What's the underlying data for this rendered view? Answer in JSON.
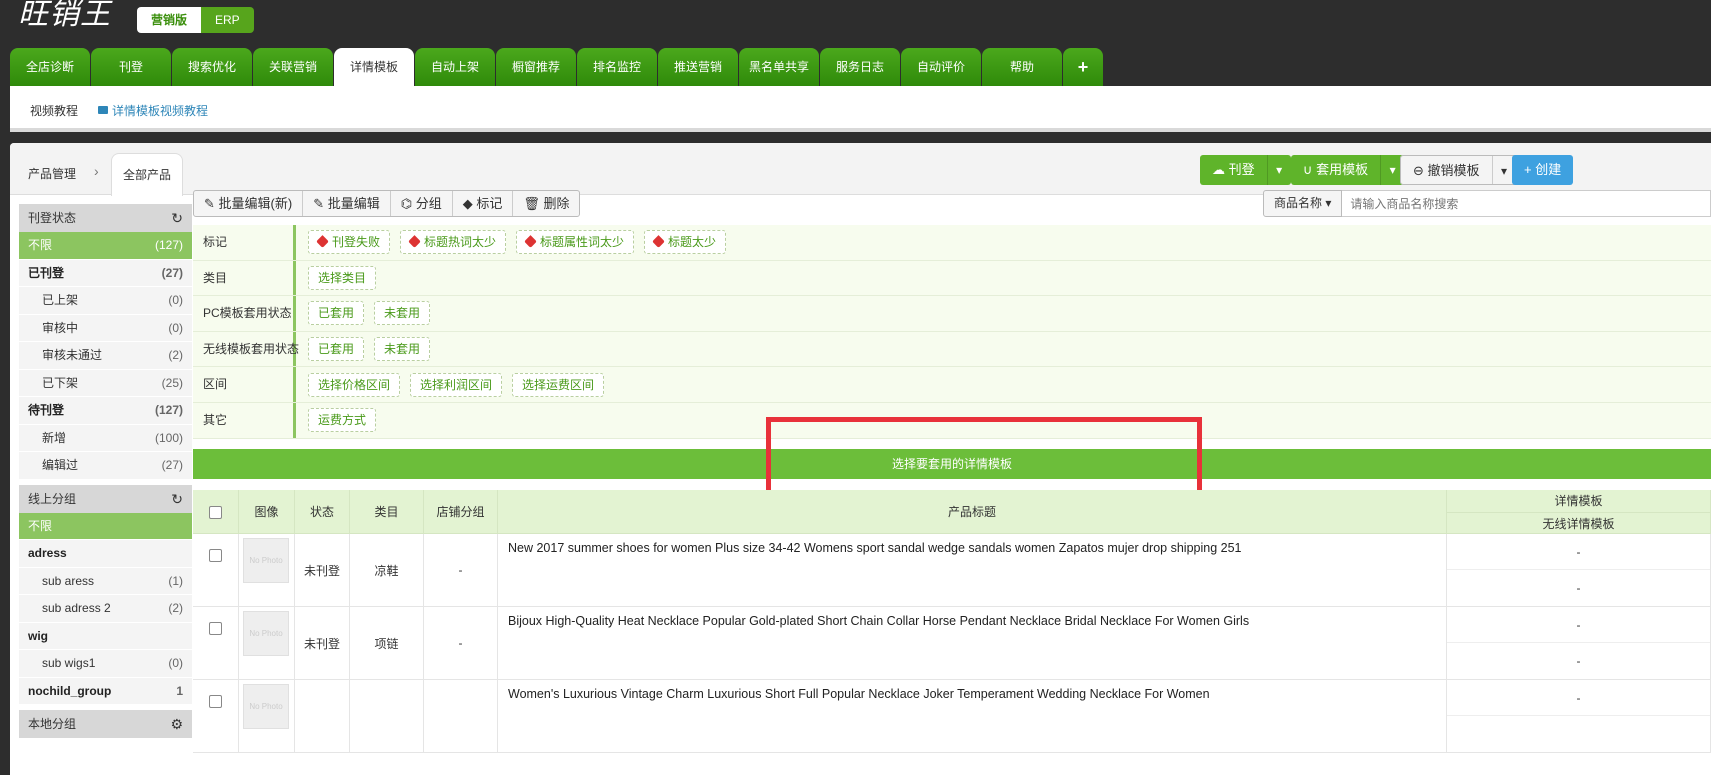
{
  "app": {
    "logo_text": "旺销王",
    "editions": [
      "营销版",
      "ERP"
    ]
  },
  "nav": {
    "tabs": [
      "全店诊断",
      "刊登",
      "搜索优化",
      "关联营销",
      "详情模板",
      "自动上架",
      "橱窗推荐",
      "排名监控",
      "推送营销",
      "黑名单共享",
      "服务日志",
      "自动评价",
      "帮助"
    ],
    "active_tab": "详情模板",
    "plus": "+"
  },
  "subbar": {
    "video_tutorial": "视频教程",
    "detail_video": "详情模板视频教程"
  },
  "breadcrumb": {
    "parent": "产品管理",
    "current": "全部产品"
  },
  "top_buttons": {
    "publish": "刊登",
    "apply_template": "套用模板",
    "revoke_template": "撤销模板",
    "create": "创建"
  },
  "sidebar": {
    "sections": [
      {
        "title": "刊登状态",
        "items": [
          {
            "label": "不限",
            "count": "(127)",
            "type": "sel"
          },
          {
            "label": "已刊登",
            "count": "(27)",
            "type": "bold"
          },
          {
            "label": "已上架",
            "count": "(0)",
            "type": "sub"
          },
          {
            "label": "审核中",
            "count": "(0)",
            "type": "sub"
          },
          {
            "label": "审核未通过",
            "count": "(2)",
            "type": "sub"
          },
          {
            "label": "已下架",
            "count": "(25)",
            "type": "sub"
          },
          {
            "label": "待刊登",
            "count": "(127)",
            "type": "bold"
          },
          {
            "label": "新增",
            "count": "(100)",
            "type": "sub"
          },
          {
            "label": "编辑过",
            "count": "(27)",
            "type": "sub"
          }
        ]
      },
      {
        "title": "线上分组",
        "items": [
          {
            "label": "不限",
            "count": "",
            "type": "sel"
          },
          {
            "label": "adress",
            "count": "",
            "type": "bold"
          },
          {
            "label": "sub aress",
            "count": "(1)",
            "type": "sub"
          },
          {
            "label": "sub adress 2",
            "count": "(2)",
            "type": "sub"
          },
          {
            "label": "wig",
            "count": "",
            "type": "bold"
          },
          {
            "label": "sub wigs1",
            "count": "(0)",
            "type": "sub"
          },
          {
            "label": "nochild_group",
            "count": "1",
            "type": "bold"
          }
        ]
      },
      {
        "title": "本地分组",
        "items": []
      }
    ]
  },
  "actions": [
    "批量编辑(新)",
    "批量编辑",
    "分组",
    "标记",
    "删除"
  ],
  "search": {
    "field": "商品名称",
    "placeholder": "请输入商品名称搜索"
  },
  "filters": [
    {
      "label": "标记",
      "tags": [
        "刊登失败",
        "标题热词太少",
        "标题属性词太少",
        "标题太少"
      ],
      "icon": true
    },
    {
      "label": "类目",
      "tags": [
        "选择类目"
      ]
    },
    {
      "label": "PC模板套用状态",
      "tags": [
        "已套用",
        "未套用"
      ]
    },
    {
      "label": "无线模板套用状态",
      "tags": [
        "已套用",
        "未套用"
      ]
    },
    {
      "label": "区间",
      "tags": [
        "选择价格区间",
        "选择利润区间",
        "选择运费区间"
      ]
    },
    {
      "label": "其它",
      "tags": [
        "运费方式"
      ]
    }
  ],
  "select_template_bar": "选择要套用的详情模板",
  "table": {
    "headers": {
      "image": "图像",
      "status": "状态",
      "category": "类目",
      "store_group": "店铺分组",
      "title": "产品标题",
      "template": "详情模板",
      "wireless": "无线详情模板"
    },
    "rows": [
      {
        "status": "未刊登",
        "category": "凉鞋",
        "group": "-",
        "title": "New 2017 summer shoes for women Plus size 34-42 Womens sport sandal wedge sandals women Zapatos mujer drop shipping 251",
        "tpl1": "-",
        "tpl2": "-"
      },
      {
        "status": "未刊登",
        "category": "项链",
        "group": "-",
        "title": "Bijoux High-Quality Heat Necklace Popular Gold-plated Short Chain Collar Horse Pendant Necklace Bridal Necklace For Women Girls",
        "tpl1": "-",
        "tpl2": "-"
      },
      {
        "status": "",
        "category": "",
        "group": "",
        "title": "Women's Luxurious Vintage Charm Luxurious Short Full Popular Necklace Joker Temperament Wedding Necklace For Women",
        "tpl1": "-",
        "tpl2": ""
      }
    ],
    "no_photo": "No Photo"
  },
  "colors": {
    "nav_green": "#3b9512",
    "selected_green": "#8cc560",
    "bar_green": "#6cbe3a",
    "highlight_red": "#e8313a",
    "link_blue": "#2e86b8"
  }
}
